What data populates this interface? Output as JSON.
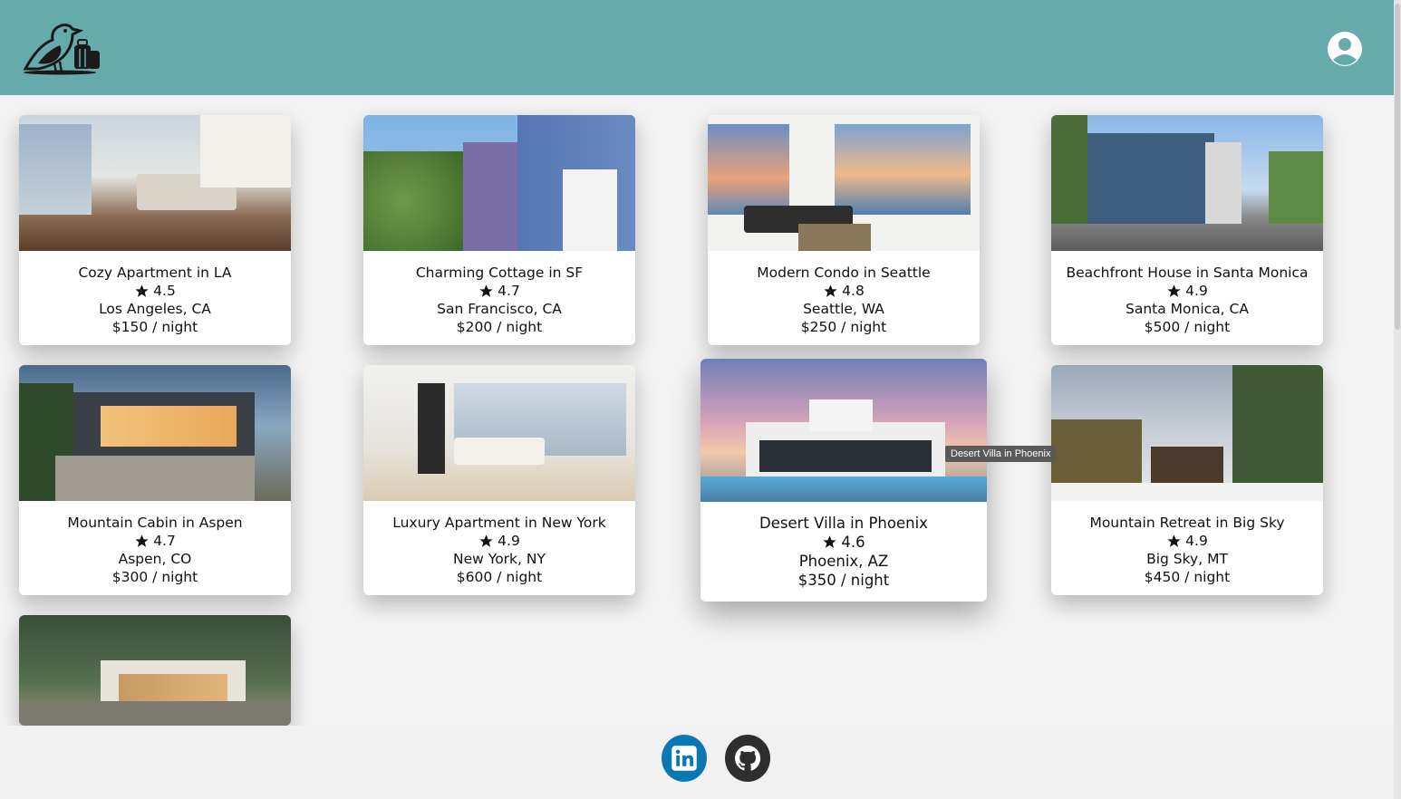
{
  "header": {
    "logo_icon": "bird-luggage-logo-icon",
    "profile_icon": "user-profile-icon"
  },
  "listings": [
    {
      "title": "Cozy Apartment in LA",
      "rating": "4.5",
      "location": "Los Angeles, CA",
      "price": "$150 / night"
    },
    {
      "title": "Charming Cottage in SF",
      "rating": "4.7",
      "location": "San Francisco, CA",
      "price": "$200 / night"
    },
    {
      "title": "Modern Condo in Seattle",
      "rating": "4.8",
      "location": "Seattle, WA",
      "price": "$250 / night"
    },
    {
      "title": "Beachfront House in Santa Monica",
      "rating": "4.9",
      "location": "Santa Monica, CA",
      "price": "$500 / night"
    },
    {
      "title": "Mountain Cabin in Aspen",
      "rating": "4.7",
      "location": "Aspen, CO",
      "price": "$300 / night"
    },
    {
      "title": "Luxury Apartment in New York",
      "rating": "4.9",
      "location": "New York, NY",
      "price": "$600 / night"
    },
    {
      "title": "Desert Villa in Phoenix",
      "rating": "4.6",
      "location": "Phoenix, AZ",
      "price": "$350 / night"
    },
    {
      "title": "Mountain Retreat in Big Sky",
      "rating": "4.9",
      "location": "Big Sky, MT",
      "price": "$450 / night"
    }
  ],
  "tooltip": "Desert Villa in Phoenix",
  "footer": {
    "linkedin_icon": "linkedin-icon",
    "github_icon": "github-icon"
  },
  "colors": {
    "header": "#66aaab",
    "linkedin": "#0a77b5",
    "github": "#2e2e2e"
  }
}
